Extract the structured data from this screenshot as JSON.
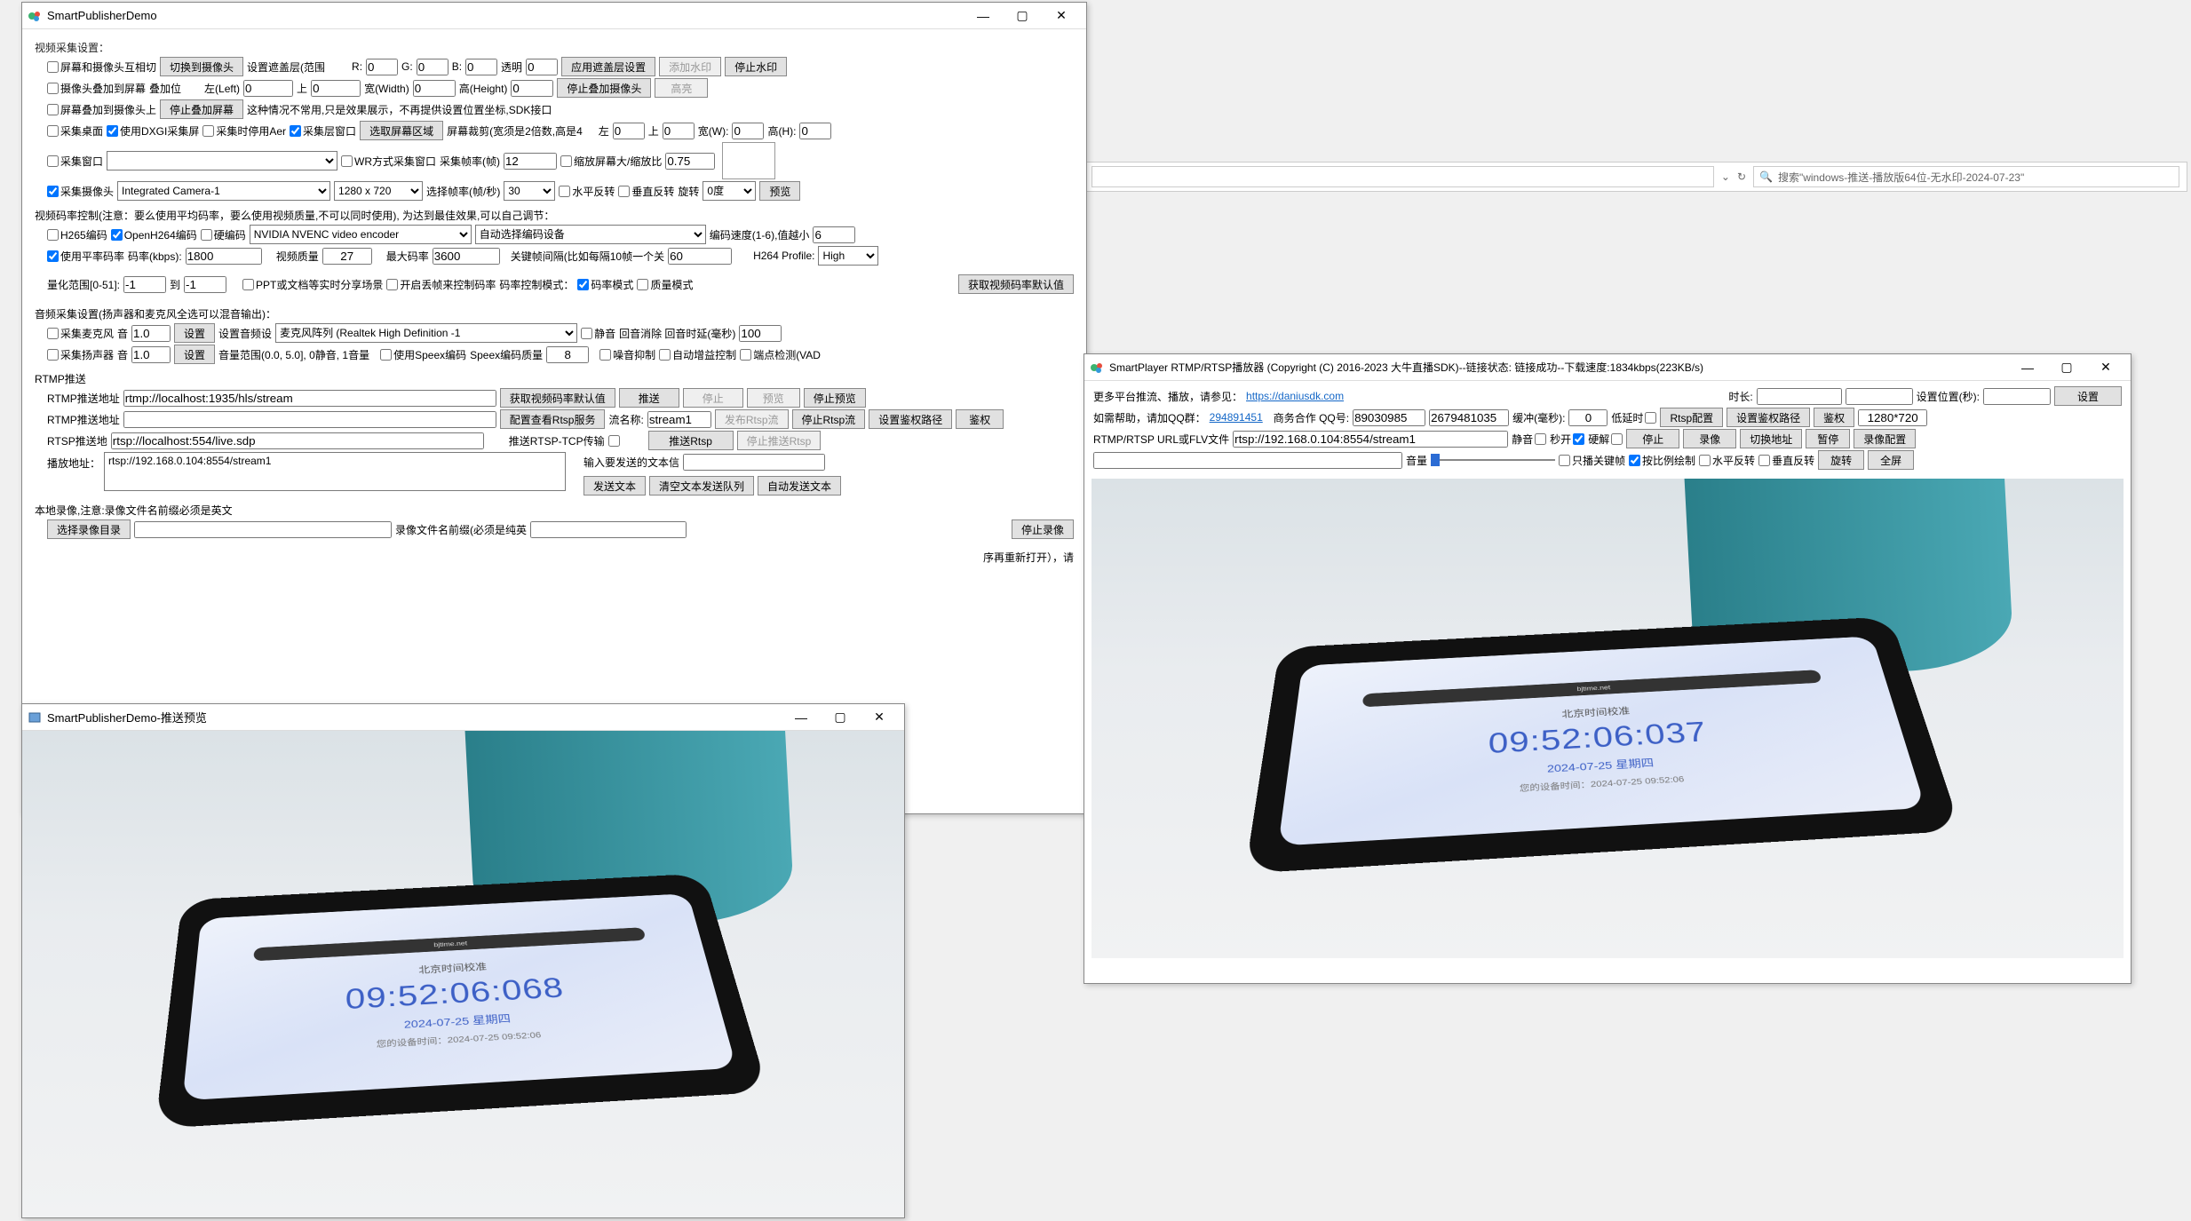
{
  "explorer": {
    "refresh": "↻",
    "search_placeholder": "搜索\"windows-推送-播放版64位-无水印-2024-07-23\""
  },
  "publisher": {
    "title": "SmartPublisherDemo",
    "sec_video": "视频采集设置：",
    "ck_screen_cam_switch": "屏幕和摄像头互相切",
    "btn_switch_to_camera": "切换到摄像头",
    "lbl_mask_range": "设置遮盖层(范围",
    "lbl_r": "R:",
    "r": "0",
    "lbl_g": "G:",
    "g": "0",
    "lbl_b": "B:",
    "b": "0",
    "lbl_alpha": "透明",
    "alpha": "0",
    "btn_apply_mask": "应用遮盖层设置",
    "btn_add_watermark": "添加水印",
    "btn_stop_watermark": "停止水印",
    "ck_cam_overlay_screen": "摄像头叠加到屏幕",
    "lbl_overlay_pos": "叠加位",
    "lbl_left": "左(Left)",
    "left": "0",
    "lbl_top": "上",
    "top": "0",
    "lbl_width": "宽(Width)",
    "width": "0",
    "lbl_height": "高(Height)",
    "height": "0",
    "btn_stop_overlay_cam": "停止叠加摄像头",
    "btn_highlight": "高亮",
    "ck_screen_overlay_cam": "屏幕叠加到摄像头上",
    "btn_stop_overlay_screen": "停止叠加屏幕",
    "note_overlay": "这种情况不常用,只是效果展示，不再提供设置位置坐标,SDK接口",
    "ck_cap_desktop": "采集桌面",
    "ck_use_dxgi": "使用DXGI采集屏",
    "ck_dxgi_disable_aero": "采集时停用Aer",
    "ck_cap_layered": "采集层窗口",
    "btn_select_region": "选取屏幕区域",
    "lbl_screen_crop": "屏幕裁剪(宽须是2倍数,高是4",
    "lbl_left2": "左",
    "left2": "0",
    "lbl_top2": "上",
    "top2": "0",
    "lbl_w2": "宽(W):",
    "w2": "0",
    "lbl_h2": "高(H):",
    "h2": "0",
    "ck_cap_window": "采集窗口",
    "ck_wr_mode": "WR方式采集窗口",
    "lbl_fps": "采集帧率(帧)",
    "fps": "12",
    "ck_scale_screen": "缩放屏幕大/缩放比",
    "scale": "0.75",
    "ck_cap_camera": "采集摄像头",
    "camera_sel": "Integrated Camera-1",
    "res_sel": "1280 x 720",
    "lbl_sel_fps": "选择帧率(帧/秒)",
    "sel_fps": "30",
    "ck_hflip": "水平反转",
    "ck_vflip": "垂直反转",
    "lbl_rotate": "旋转",
    "rotate_sel": "0度",
    "btn_preview": "预览",
    "rate_ctrl_note": "视频码率控制(注意：要么使用平均码率，要么使用视频质量,不可以同时使用), 为达到最佳效果,可以自己调节：",
    "ck_h265": "H265编码",
    "ck_openh264": "OpenH264编码",
    "ck_hw": "硬编码",
    "hw_encoder": "NVIDIA NVENC video encoder",
    "auto_device": "自动选择编码设备",
    "lbl_speed": "编码速度(1-6),值越小",
    "speed": "6",
    "ck_avg_rate": "使用平率码率",
    "lbl_bitrate": "码率(kbps):",
    "bitrate": "1800",
    "lbl_vq": "视频质量",
    "vq": "27",
    "lbl_max_rate": "最大码率",
    "max_rate": "3600",
    "lbl_keyint": "关键帧间隔(比如每隔10帧一个关",
    "keyint": "60",
    "lbl_profile": "H264 Profile:",
    "profile": "High",
    "lbl_qr": "量化范围[0-51]:",
    "qr_lo": "-1",
    "lbl_to": "到",
    "qr_hi": "-1",
    "ck_ppt_share": "PPT或文档等实时分享场景",
    "ck_drop_ctrl": "开启丢帧来控制码率",
    "lbl_rate_mode": "码率控制模式：",
    "ck_rate_mode": "码率模式",
    "ck_quality_mode": "质量模式",
    "btn_get_rate_defaults": "获取视频码率默认值",
    "sec_audio": "音频采集设置(扬声器和麦克风全选可以混音输出)：",
    "ck_mic": "采集麦克风",
    "lbl_vol": "音",
    "mic_vol": "1.0",
    "btn_set1": "设置",
    "lbl_audio_cfg": "设置音频设",
    "audio_dev": "麦克风阵列 (Realtek High Definition -1",
    "ck_mute": "静音",
    "lbl_echo": "回音消除 回音时延(毫秒)",
    "echo": "100",
    "ck_speaker": "采集扬声器",
    "spk_vol": "1.0",
    "btn_set2": "设置",
    "lbl_vol_range": "音量范围(0.0, 5.0], 0静音, 1音量",
    "ck_speex": "使用Speex编码",
    "lbl_speex_q": "Speex编码质量",
    "speex_q": "8",
    "ck_ns": "噪音抑制",
    "ck_agc": "自动增益控制",
    "ck_vad": "端点检测(VAD",
    "sec_rtmp": "RTMP推送",
    "lbl_rtmp_addr": "RTMP推送地址",
    "rtmp_addr": "rtmp://localhost:1935/hls/stream",
    "btn_rate_defaults2": "获取视频码率默认值",
    "btn_push": "推送",
    "btn_stop": "停止",
    "btn_prev2": "预览",
    "btn_stop_prev": "停止预览",
    "lbl_rtmp_addr2": "RTMP推送地址",
    "btn_cfg_rtsp": "配置查看Rtsp服务",
    "lbl_stream_name": "流名称:",
    "stream_name": "stream1",
    "btn_pub_rtsp": "发布Rtsp流",
    "btn_stop_rtsp": "停止Rtsp流",
    "btn_set_auth": "设置鉴权路径",
    "btn_auth": "鉴权",
    "lbl_rtsp_addr": "RTSP推送地",
    "rtsp_addr": "rtsp://localhost:554/live.sdp",
    "lbl_rtsp_tcp": "推送RTSP-TCP传输",
    "btn_push_rtsp": "推送Rtsp",
    "btn_stop_push_rtsp": "停止推送Rtsp",
    "lbl_play_addr": "播放地址：",
    "play_addr": "rtsp://192.168.0.104:8554/stream1",
    "lbl_text_input": "输入要发送的文本信",
    "btn_send_text": "发送文本",
    "btn_clear_text": "清空文本发送队列",
    "btn_auto_send": "自动发送文本",
    "note_record": "本地录像,注意:录像文件名前缀必须是英文",
    "btn_choose_dir": "选择录像目录",
    "lbl_rec_prefix": "录像文件名前缀(必须是纯英",
    "btn_stop_rec": "停止录像",
    "note_restart": "序再重新打开），请"
  },
  "preview": {
    "title": "SmartPublisherDemo-推送预览",
    "phone_url": "bjtime.net",
    "phone_title": "北京时间校准",
    "phone_time": "09:52:06:068",
    "phone_date": "2024-07-25 星期四",
    "phone_sub": "您的设备时间：2024-07-25 09:52:06"
  },
  "player": {
    "title": "SmartPlayer RTMP/RTSP播放器 (Copyright (C) 2016-2023 大牛直播SDK)--链接状态: 链接成功--下载速度:1834kbps(223KB/s)",
    "help_note": "更多平台推流、播放，请参见：",
    "help_url": "https://daniusdk.com",
    "lbl_duration": "时长:",
    "lbl_setpos": "设置位置(秒):",
    "btn_set": "设置",
    "lbl_need_help": "如需帮助，请加QQ群：",
    "qq_group": "294891451",
    "lbl_biz": "商务合作 QQ号:",
    "qq1": "89030985",
    "qq2": "2679481035",
    "lbl_buffer": "缓冲(毫秒):",
    "buffer": "0",
    "ck_low_latency": "低延时",
    "btn_rtsp_cfg": "Rtsp配置",
    "btn_auth_path": "设置鉴权路径",
    "btn_auth": "鉴权",
    "res": "1280*720",
    "lbl_url": "RTMP/RTSP URL或FLV文件",
    "url": "rtsp://192.168.0.104:8554/stream1",
    "ck_mute": "静音",
    "ck_sec_on": "秒开",
    "ck_hw_dec": "硬解",
    "btn_stop": "停止",
    "btn_rec": "录像",
    "btn_switch_addr": "切换地址",
    "btn_pause": "暂停",
    "btn_rec_cfg": "录像配置",
    "lbl_volume": "音量",
    "ck_keyframe_only": "只播关键帧",
    "ck_scale_draw": "按比例绘制",
    "ck_hflip": "水平反转",
    "ck_vflip": "垂直反转",
    "btn_rotate": "旋转",
    "btn_fullscreen": "全屏",
    "phone_url": "bjtime.net",
    "phone_title": "北京时间校准",
    "phone_time": "09:52:06:037",
    "phone_date": "2024-07-25 星期四",
    "phone_sub": "您的设备时间：2024-07-25 09:52:06"
  }
}
